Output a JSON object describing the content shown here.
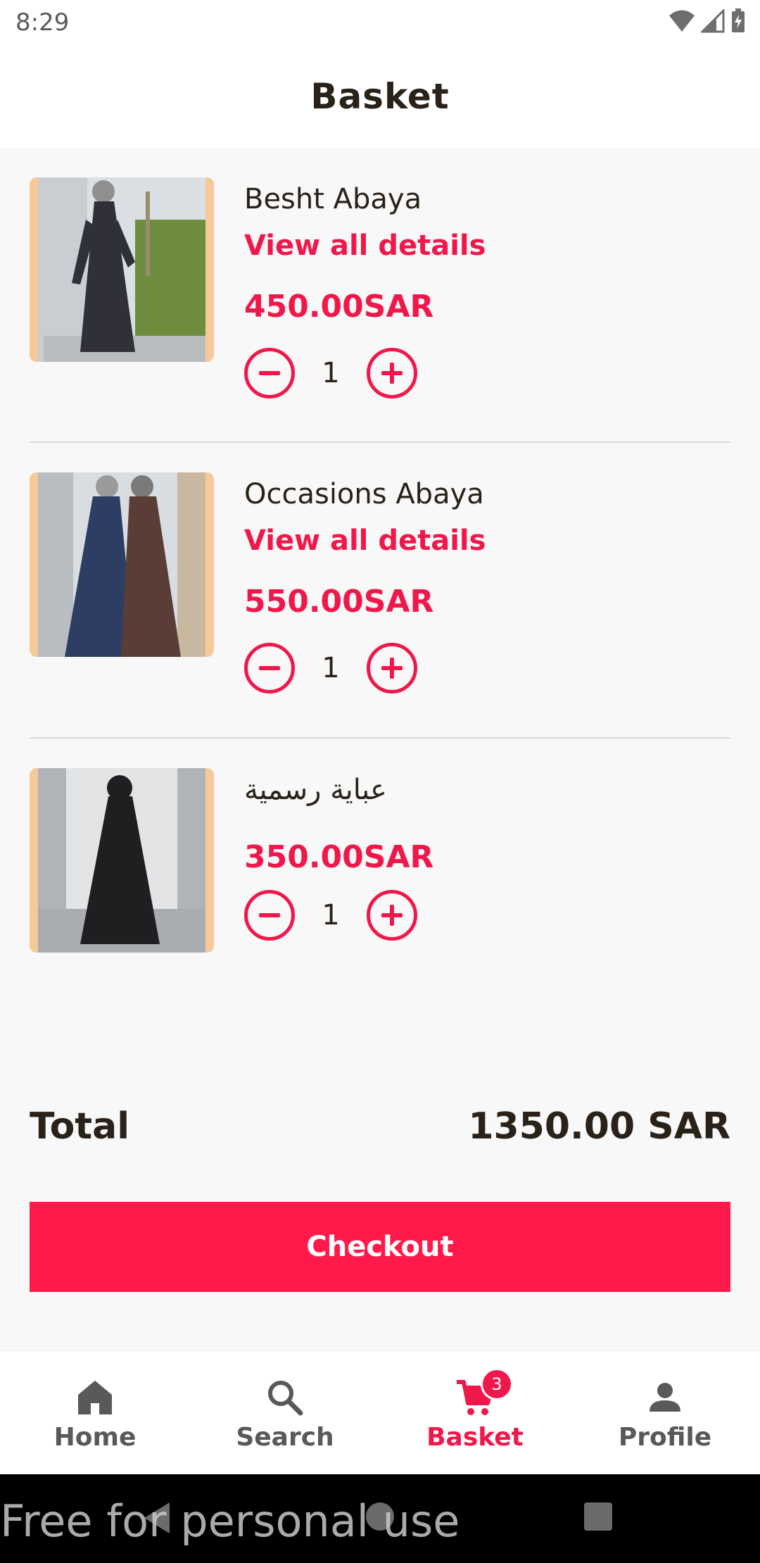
{
  "status_bar": {
    "time": "8:29"
  },
  "header": {
    "title": "Basket"
  },
  "cart": {
    "items": [
      {
        "name": "Besht Abaya",
        "link_label": "View all details",
        "price": "450.00SAR",
        "quantity": "1",
        "image_icon": "abaya-photo"
      },
      {
        "name": "Occasions Abaya",
        "link_label": "View all details",
        "price": "550.00SAR",
        "quantity": "1",
        "image_icon": "abaya-photo"
      },
      {
        "name": "عباية رسمية",
        "price": "350.00SAR",
        "quantity": "1",
        "image_icon": "abaya-photo"
      }
    ]
  },
  "summary": {
    "total_label": "Total",
    "total_value": "1350.00 SAR"
  },
  "checkout": {
    "label": "Checkout"
  },
  "bottom_nav": {
    "items": [
      {
        "label": "Home",
        "icon": "home-icon",
        "active": false
      },
      {
        "label": "Search",
        "icon": "search-icon",
        "active": false
      },
      {
        "label": "Basket",
        "icon": "cart-icon",
        "active": true,
        "badge": "3"
      },
      {
        "label": "Profile",
        "icon": "person-icon",
        "active": false
      }
    ]
  },
  "watermark": {
    "text": "Free for personal use"
  },
  "colors": {
    "accent": "#f0184a",
    "checkout_bg": "#ff1a4b",
    "text_dark": "#2a2218",
    "nav_inactive": "#595959",
    "background": "#f8f8f8"
  }
}
